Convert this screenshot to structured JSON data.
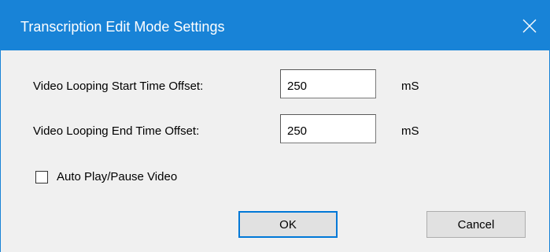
{
  "window": {
    "title": "Transcription Edit Mode Settings",
    "accent_color": "#1883d7",
    "close_icon": "close-icon"
  },
  "fields": {
    "start_offset": {
      "label": "Video Looping Start Time Offset:",
      "value": "250",
      "unit": "mS"
    },
    "end_offset": {
      "label": "Video Looping End Time Offset:",
      "value": "250",
      "unit": "mS"
    }
  },
  "auto_play": {
    "label": "Auto Play/Pause Video",
    "checked": false
  },
  "buttons": {
    "ok": "OK",
    "cancel": "Cancel"
  }
}
